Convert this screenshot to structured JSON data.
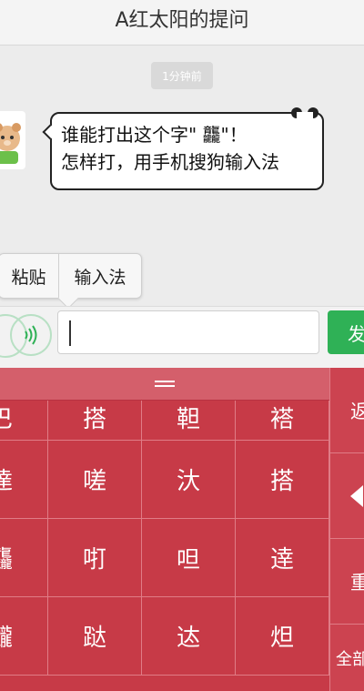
{
  "header": {
    "title": "A红太阳的提问"
  },
  "chat": {
    "timestamp": "1分钟前",
    "message_line1": "谁能打出这个字\" 龘\"！",
    "message_line2": "怎样打，用手机搜狗输入法"
  },
  "context_menu": {
    "paste": "粘贴",
    "input_method": "输入法"
  },
  "composer": {
    "input_value": "",
    "send_label": "发"
  },
  "keyboard": {
    "candidates": [
      [
        "巴",
        "搭",
        "靼",
        "褡"
      ],
      [
        "達",
        "嗟",
        "汏",
        "搭"
      ],
      [
        "龘",
        "咑",
        "呾",
        "逹"
      ],
      [
        "龖",
        "跶",
        "迏",
        "炟"
      ]
    ],
    "side_buttons": {
      "back": "返",
      "redo": "重",
      "all": "全部"
    },
    "accent_color": "#c73a47"
  }
}
